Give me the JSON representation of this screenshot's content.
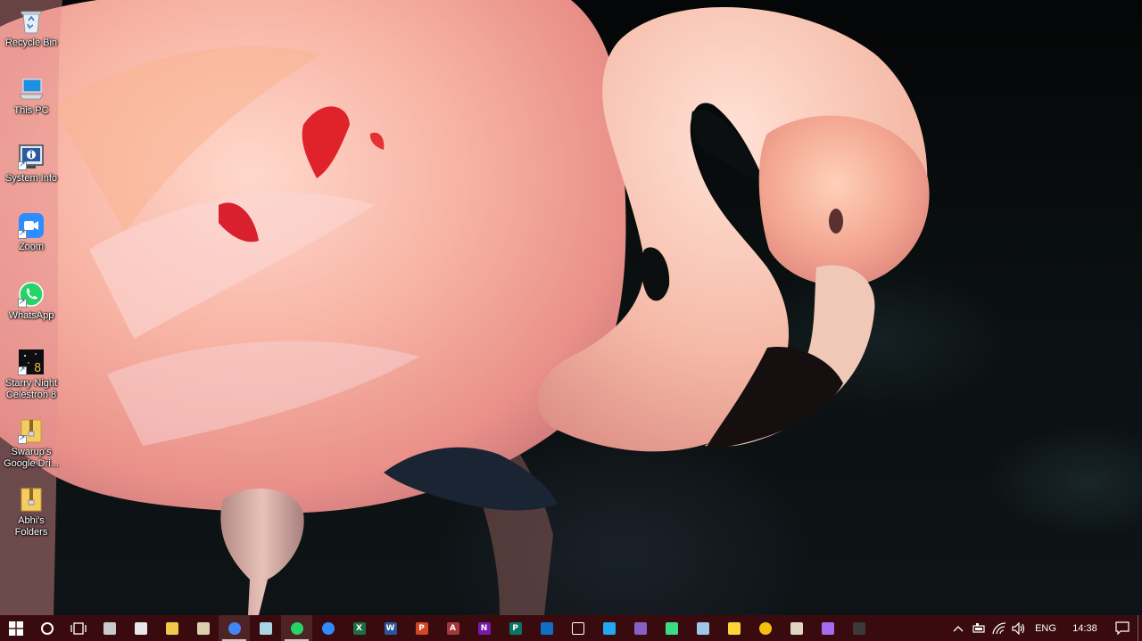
{
  "desktop": {
    "icons": [
      {
        "id": "recycle-bin",
        "label": "Recycle Bin"
      },
      {
        "id": "this-pc",
        "label": "This PC"
      },
      {
        "id": "system-info",
        "label": "System Info"
      },
      {
        "id": "zoom",
        "label": "Zoom"
      },
      {
        "id": "whatsapp",
        "label": "WhatsApp"
      },
      {
        "id": "starry-night",
        "label": "Starry Night\nCelestron 8"
      },
      {
        "id": "google-drive",
        "label": "Swarup's\nGoogle Dri..."
      },
      {
        "id": "abhis-folders",
        "label": "Abhi's\nFolders"
      }
    ]
  },
  "taskbar": {
    "start_icon": "windows-logo-icon",
    "search_icon": "cortana-circle-icon",
    "taskview_icon": "task-view-icon",
    "pinned_apps": [
      {
        "icon": "app-tool-icon",
        "letter": "",
        "color": "#c9c9c9"
      },
      {
        "icon": "calculator-icon",
        "letter": "",
        "color": "#e8e8e8"
      },
      {
        "icon": "file-explorer-icon",
        "letter": "",
        "color": "#f2c94c"
      },
      {
        "icon": "snipping-tool-icon",
        "letter": "",
        "color": "#d8d0b0"
      },
      {
        "icon": "chrome-icon",
        "letter": "",
        "color": "#4285f4"
      },
      {
        "icon": "notepad-icon",
        "letter": "",
        "color": "#a8d4e6"
      },
      {
        "icon": "whatsapp-icon",
        "letter": "",
        "color": "#25d366"
      },
      {
        "icon": "zoom-icon",
        "letter": "",
        "color": "#2d8cff"
      },
      {
        "icon": "excel-icon",
        "letter": "X",
        "color": "#1d6f42"
      },
      {
        "icon": "word-icon",
        "letter": "W",
        "color": "#2b579a"
      },
      {
        "icon": "powerpoint-icon",
        "letter": "P",
        "color": "#d24726"
      },
      {
        "icon": "access-icon",
        "letter": "A",
        "color": "#a4373a"
      },
      {
        "icon": "onenote-icon",
        "letter": "N",
        "color": "#7719aa"
      },
      {
        "icon": "publisher-icon",
        "letter": "P",
        "color": "#077568"
      },
      {
        "icon": "outlook-icon",
        "letter": "",
        "color": "#0f6fc6"
      },
      {
        "icon": "mail-icon",
        "letter": "",
        "color": "#ffffff"
      },
      {
        "icon": "vscode-icon",
        "letter": "",
        "color": "#22a7f2"
      },
      {
        "icon": "visual-studio-icon",
        "letter": "",
        "color": "#8661c5"
      },
      {
        "icon": "android-studio-icon",
        "letter": "",
        "color": "#3ddc84"
      },
      {
        "icon": "computer-window-icon",
        "letter": "",
        "color": "#9ec7e8"
      },
      {
        "icon": "python-icon",
        "letter": "",
        "color": "#ffd43b"
      },
      {
        "icon": "emoji-icon",
        "letter": "",
        "color": "#f4c20d"
      },
      {
        "icon": "paint-icon",
        "letter": "",
        "color": "#e0d5c0"
      },
      {
        "icon": "maps-pin-icon",
        "letter": "",
        "color": "#a66cf0"
      },
      {
        "icon": "starry-night-icon",
        "letter": "",
        "color": "#3a3a3a"
      }
    ],
    "tray": {
      "chevron_icon": "chevron-up-icon",
      "battery_icon": "battery-icon",
      "wifi_icon": "wifi-icon",
      "volume_icon": "volume-icon",
      "language": "ENG",
      "time": "14:38",
      "notification_icon": "action-center-icon"
    }
  }
}
